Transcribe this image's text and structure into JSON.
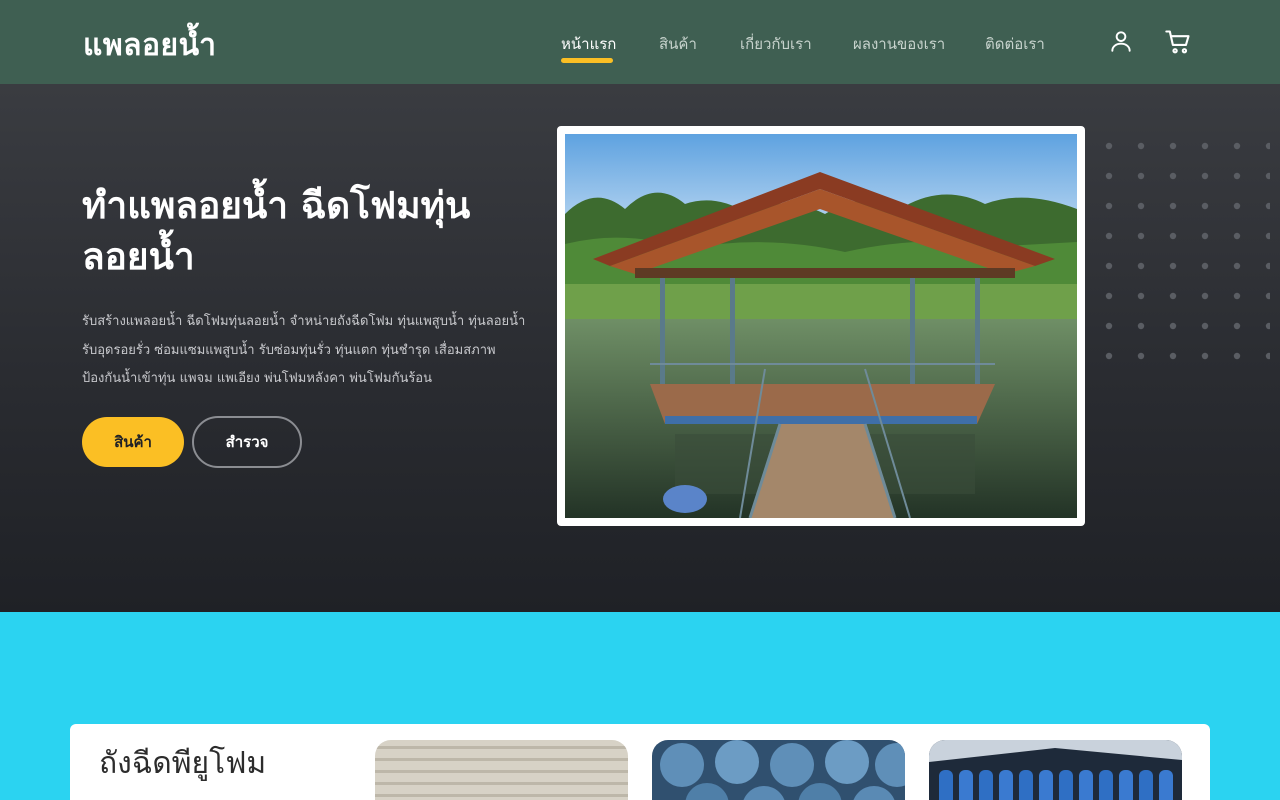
{
  "brand": {
    "logo": "แพลอยน้ำ"
  },
  "nav": {
    "items": [
      {
        "label": "หน้าแรก",
        "active": true
      },
      {
        "label": "สินค้า",
        "active": false
      },
      {
        "label": "เกี่ยวกับเรา",
        "active": false
      },
      {
        "label": "ผลงานของเรา",
        "active": false
      },
      {
        "label": "ติดต่อเรา",
        "active": false
      }
    ],
    "icons": [
      "user-icon",
      "cart-icon"
    ]
  },
  "hero": {
    "title_line1": "ทำแพลอยน้ำ ฉีดโฟมทุ่น",
    "title_line2": "ลอยน้ำ",
    "description": "รับสร้างแพลอยน้ำ ฉีดโฟมทุ่นลอยน้ำ จำหน่ายถังฉีดโฟม ทุ่นแพสูบน้ำ ทุ่นลอยน้ำ รับอุดรอยรั่ว ซ่อมแซมแพสูบน้ำ รับซ่อมทุ่นรั่ว ทุ่นแตก ทุ่นชำรุด เสื่อมสภาพป้องกันน้ำเข้าทุ่น แพจม แพเอียง พ่นโฟมหลังคา พ่นโฟมกันร้อน",
    "primary_button": "สินค้า",
    "secondary_button": "สำรวจ"
  },
  "products": {
    "heading": "ถังฉีดพียูโฟม"
  },
  "colors": {
    "header_bg": "#3f5f52",
    "accent": "#fbbf24",
    "section_bg": "#2bd3f1",
    "hero_bg": "#2a2c31"
  }
}
